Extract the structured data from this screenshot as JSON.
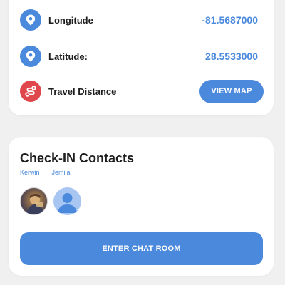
{
  "location": {
    "rows": [
      {
        "label": "Longitude",
        "value": "-81.5687000",
        "icon": "map-pin-icon"
      },
      {
        "label": "Latitude:",
        "value": "28.5533000",
        "icon": "map-pin-icon"
      },
      {
        "label": "Travel Distance",
        "icon": "route-icon"
      }
    ],
    "view_map_label": "VIEW MAP"
  },
  "contacts": {
    "title": "Check-IN Contacts",
    "names": [
      "Kerwin",
      "Jemila"
    ],
    "enter_chat_label": "ENTER CHAT ROOM"
  },
  "colors": {
    "accent": "#4a89dc",
    "route": "#e0474c",
    "background": "#f0f0f0",
    "card": "#ffffff"
  }
}
